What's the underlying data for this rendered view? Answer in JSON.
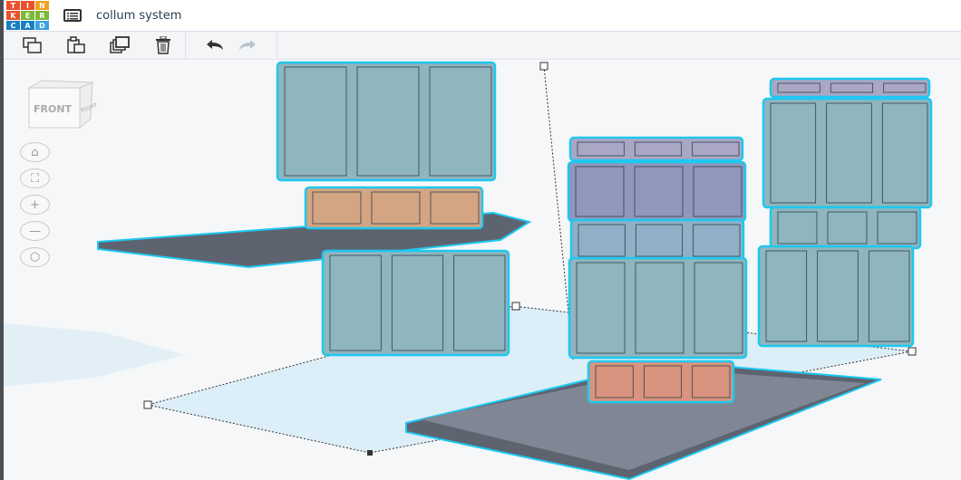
{
  "app": {
    "logo_letters": [
      "T",
      "I",
      "N",
      "K",
      "E",
      "R",
      "C",
      "A",
      "D"
    ],
    "logo_colors": [
      "#e9502d",
      "#e9502d",
      "#e9502d",
      "#e9502d",
      "#e9502d",
      "#e9502d",
      "#1a7fc4",
      "#1a7fc4",
      "#1a7fc4"
    ],
    "title": "collum system"
  },
  "toolbar": {
    "copy": "copy-icon",
    "paste": "paste-icon",
    "duplicate": "duplicate-icon",
    "delete": "trash-icon",
    "undo": "undo-icon",
    "redo": "redo-icon"
  },
  "viewcube": {
    "front": "FRONT",
    "right": "RIGHT"
  },
  "controls": [
    "home",
    "fit",
    "zoom-in",
    "zoom-out",
    "perspective"
  ],
  "colors": {
    "accent": "#1ec8f0",
    "part": "#8fb5bf",
    "plate": "#5d6470",
    "workplane": "#dff0f8"
  }
}
